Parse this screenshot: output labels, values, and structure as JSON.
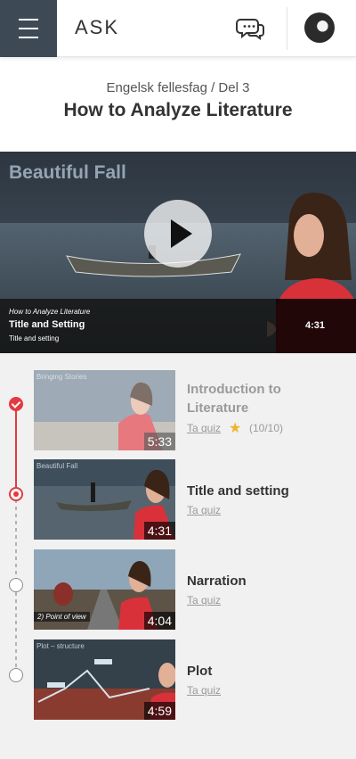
{
  "header": {
    "logo": "ASK"
  },
  "course": {
    "breadcrumb": "Engelsk fellesfag / Del 3",
    "title": "How to Analyze Literature"
  },
  "hero": {
    "overlay_title": "Beautiful Fall",
    "series": "How to Analyze Literature",
    "episode": "Title and Setting",
    "subtitle": "Title and setting",
    "duration": "4:31"
  },
  "episodes": [
    {
      "title_line1": "Introduction to",
      "title_line2": "Literature",
      "quiz": "Ta quiz",
      "score": "(10/10)",
      "duration": "5:33",
      "thumb_tag": "Bringing Stories",
      "status": "completed"
    },
    {
      "title": "Title and setting",
      "quiz": "Ta quiz",
      "duration": "4:31",
      "thumb_tag": "Beautiful Fall",
      "status": "current"
    },
    {
      "title": "Narration",
      "quiz": "Ta quiz",
      "duration": "4:04",
      "thumb_label": "2) Point of view",
      "status": "not-started"
    },
    {
      "title": "Plot",
      "quiz": "Ta quiz",
      "duration": "4:59",
      "thumb_tag": "Plot – structure",
      "status": "not-started"
    }
  ],
  "icons": {
    "menu": "menu-icon",
    "chat": "chat-bubbles-icon",
    "play": "play-icon",
    "check": "check-icon",
    "star": "star-icon"
  },
  "colors": {
    "menu_bg": "#3d4a56",
    "accent": "#e4393f",
    "star": "#f0b429"
  }
}
